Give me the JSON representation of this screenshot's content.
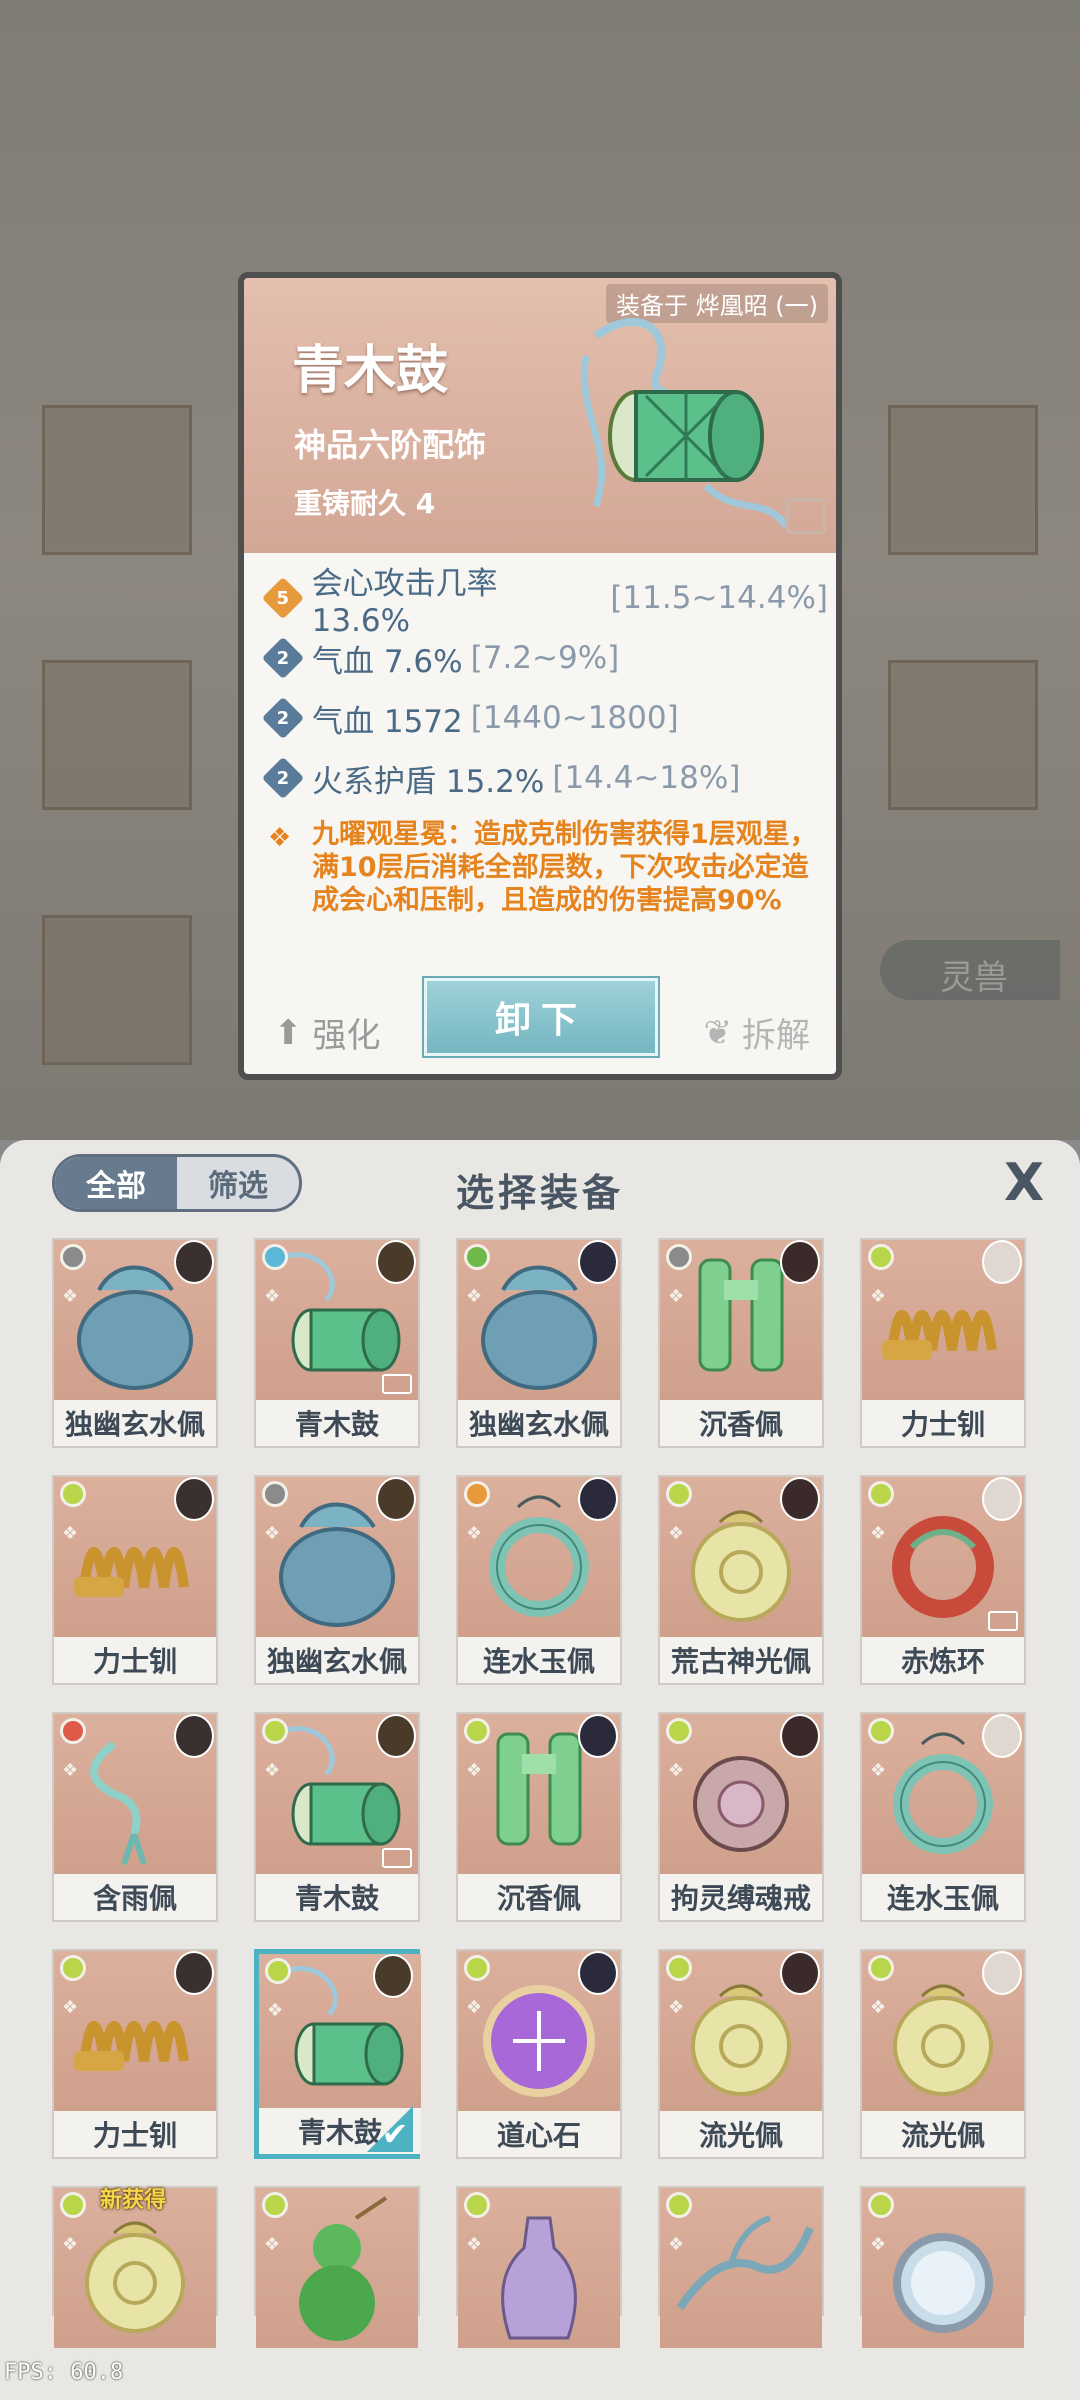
{
  "background": {
    "side_tag": "灵兽"
  },
  "detail": {
    "equipped_on": "装备于 烨凰昭 (一)",
    "name": "青木鼓",
    "grade": "神品六阶配饰",
    "durability": "重铸耐久 4",
    "stats": [
      {
        "badge": "5",
        "badge_color": "#e69a3c",
        "text": "会心攻击几率 13.6%",
        "range": "[11.5~14.4%]"
      },
      {
        "badge": "2",
        "badge_color": "#5a7b9a",
        "text": "气血 7.6%",
        "range": "[7.2~9%]"
      },
      {
        "badge": "2",
        "badge_color": "#5a7b9a",
        "text": "气血 1572",
        "range": "[1440~1800]"
      },
      {
        "badge": "2",
        "badge_color": "#5a7b9a",
        "text": "火系护盾 15.2%",
        "range": "[14.4~18%]"
      }
    ],
    "special_text": "九曜观星冕：造成克制伤害获得1层观星，满10层后消耗全部层数，下次攻击必定造成会心和压制，且造成的伤害提高90%",
    "enhance_label": "强化",
    "unequip_label": "卸下",
    "dismantle_label": "拆解"
  },
  "panel": {
    "filter_all": "全部",
    "filter_screen": "筛选",
    "title": "选择装备",
    "close_symbol": "X",
    "items": [
      {
        "label": "独幽玄水佩",
        "art": "jar-blue",
        "element": "#8b8b8b"
      },
      {
        "label": "青木鼓",
        "art": "drum-green",
        "element": "#5bb7d8",
        "locked": true
      },
      {
        "label": "独幽玄水佩",
        "art": "jar-blue",
        "element": "#6fb84a"
      },
      {
        "label": "沉香佩",
        "art": "jade-green",
        "element": "#8b8b8b"
      },
      {
        "label": "力士钏",
        "art": "coil-gold",
        "element": "#b9d64a"
      },
      {
        "label": "力士钏",
        "art": "coil-gold",
        "element": "#b9d64a"
      },
      {
        "label": "独幽玄水佩",
        "art": "jar-blue",
        "element": "#8b8b8b"
      },
      {
        "label": "连水玉佩",
        "art": "ring-teal",
        "element": "#e69a3c"
      },
      {
        "label": "荒古神光佩",
        "art": "pendant-cream",
        "element": "#b9d64a"
      },
      {
        "label": "赤炼环",
        "art": "ring-red",
        "element": "#b9d64a",
        "locked": true
      },
      {
        "label": "含雨佩",
        "art": "tassel-teal",
        "element": "#e05a4a"
      },
      {
        "label": "青木鼓",
        "art": "drum-green",
        "element": "#b9d64a",
        "locked": true
      },
      {
        "label": "沉香佩",
        "art": "jade-green",
        "element": "#b9d64a"
      },
      {
        "label": "拘灵缚魂戒",
        "art": "ring-pink",
        "element": "#b9d64a"
      },
      {
        "label": "连水玉佩",
        "art": "ring-teal",
        "element": "#b9d64a"
      },
      {
        "label": "力士钏",
        "art": "coil-gold",
        "element": "#b9d64a"
      },
      {
        "label": "青木鼓",
        "art": "drum-green",
        "element": "#b9d64a",
        "selected": true
      },
      {
        "label": "道心石",
        "art": "orb-purple",
        "element": "#b9d64a"
      },
      {
        "label": "流光佩",
        "art": "pendant-cream",
        "element": "#b9d64a"
      },
      {
        "label": "流光佩",
        "art": "pendant-cream",
        "element": "#b9d64a"
      },
      {
        "label": "",
        "art": "pendant-cream",
        "element": "#b9d64a",
        "new_tag": "新获得"
      },
      {
        "label": "",
        "art": "gourd-green",
        "element": "#b9d64a"
      },
      {
        "label": "",
        "art": "vase-purple",
        "element": "#b9d64a"
      },
      {
        "label": "",
        "art": "branch-blue",
        "element": "#b9d64a"
      },
      {
        "label": "",
        "art": "mirror-silver",
        "element": "#b9d64a"
      }
    ]
  },
  "fps": "FPS: 60.8"
}
